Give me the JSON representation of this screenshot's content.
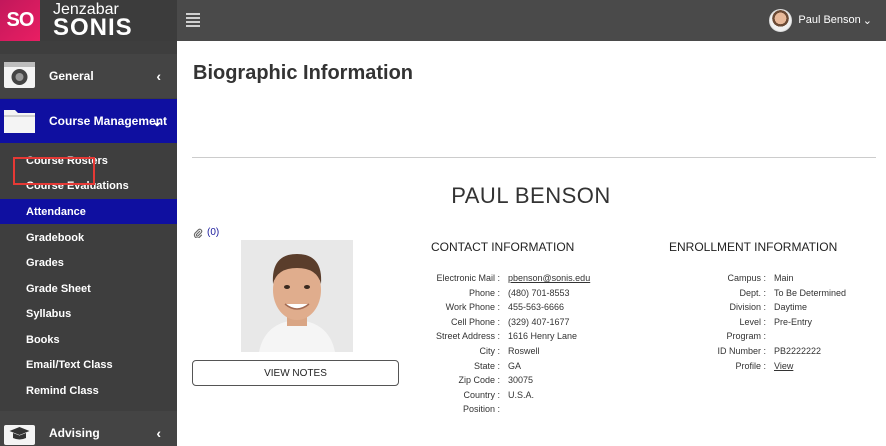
{
  "header": {
    "logo_badge": "SO",
    "logo_line1": "Jenzabar",
    "logo_line2": "SONIS",
    "user_name": "Paul Benson",
    "user_chevron": "⌄"
  },
  "sidebar": {
    "sections": {
      "general": {
        "label": "General",
        "chevron": "‹",
        "icon": "general-icon"
      },
      "course_management": {
        "label": "Course Management",
        "chevron": "⌄",
        "icon": "folder-icon"
      },
      "advising": {
        "label": "Advising",
        "chevron": "‹",
        "icon": "graduation-cap-icon"
      }
    },
    "items": [
      {
        "label": "Course Rosters"
      },
      {
        "label": "Course Evaluations"
      },
      {
        "label": "Attendance",
        "active": true
      },
      {
        "label": "Gradebook"
      },
      {
        "label": "Grades"
      },
      {
        "label": "Grade Sheet"
      },
      {
        "label": "Syllabus"
      },
      {
        "label": "Books"
      },
      {
        "label": "Email/Text Class"
      },
      {
        "label": "Remind Class"
      }
    ]
  },
  "main": {
    "title": "Biographic Information",
    "person_name": "PAUL BENSON",
    "attachments": "(0)",
    "view_notes": "VIEW NOTES",
    "contact": {
      "heading": "CONTACT INFORMATION",
      "rows": [
        {
          "label": "Electronic Mail :",
          "value": "pbenson@sonis.edu",
          "style": "link"
        },
        {
          "label": "Phone :",
          "value": "(480) 701-8553",
          "style": "blue"
        },
        {
          "label": "Work Phone :",
          "value": "455-563-6666",
          "style": "blue"
        },
        {
          "label": "Cell Phone :",
          "value": "(329) 407-1677",
          "style": "blue"
        },
        {
          "label": "Street Address :",
          "value": "1616 Henry Lane",
          "style": "plain"
        },
        {
          "label": "City :",
          "value": "Roswell",
          "style": "plain"
        },
        {
          "label": "State :",
          "value": "GA",
          "style": "plain"
        },
        {
          "label": "Zip Code :",
          "value": "30075",
          "style": "plain"
        },
        {
          "label": "Country :",
          "value": "U.S.A.",
          "style": "plain"
        },
        {
          "label": "Position :",
          "value": "",
          "style": "plain"
        }
      ]
    },
    "enrollment": {
      "heading": "ENROLLMENT INFORMATION",
      "rows": [
        {
          "label": "Campus :",
          "value": "Main",
          "style": "plain"
        },
        {
          "label": "Dept. :",
          "value": "To Be Determined",
          "style": "plain"
        },
        {
          "label": "Division :",
          "value": "Daytime",
          "style": "plain"
        },
        {
          "label": "Level :",
          "value": "Pre-Entry",
          "style": "plain"
        },
        {
          "label": "Program :",
          "value": "",
          "style": "plain"
        },
        {
          "label": "ID Number :",
          "value": "PB2222222",
          "style": "plain"
        },
        {
          "label": "Profile :",
          "value": "View",
          "style": "link"
        }
      ]
    }
  },
  "colors": {
    "topbar": "#4a4a4a",
    "sidebar": "#3e3e3e",
    "active_blue": "#0f0fa0",
    "link_blue": "#1a1a9c",
    "highlight_red": "#e53935"
  }
}
